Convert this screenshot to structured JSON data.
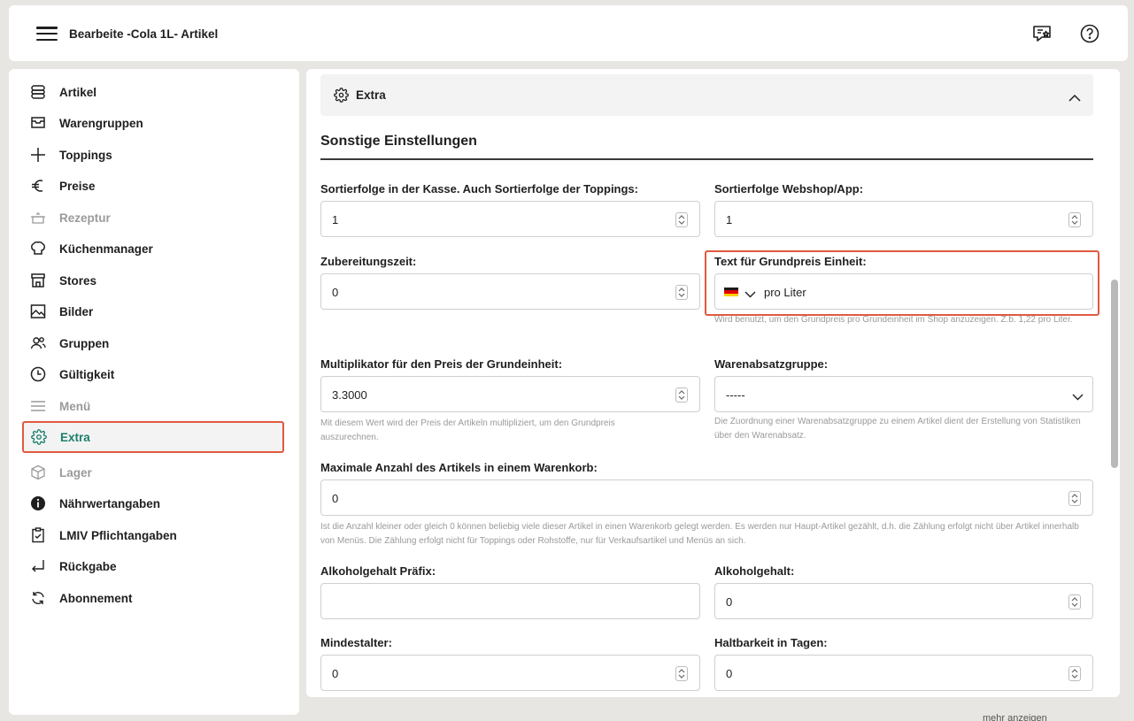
{
  "header": {
    "title": "Bearbeite -Cola 1L- Artikel",
    "icons": [
      "menu-icon",
      "feedback-icon",
      "help-icon"
    ]
  },
  "sidebar": {
    "items": [
      {
        "label": "Artikel",
        "icon": "stack-icon",
        "state": "normal"
      },
      {
        "label": "Warengruppen",
        "icon": "tray-icon",
        "state": "normal"
      },
      {
        "label": "Toppings",
        "icon": "plus-icon",
        "state": "normal"
      },
      {
        "label": "Preise",
        "icon": "euro-icon",
        "state": "normal"
      },
      {
        "label": "Rezeptur",
        "icon": "pot-icon",
        "state": "disabled"
      },
      {
        "label": "Küchenmanager",
        "icon": "chef-hat-icon",
        "state": "normal"
      },
      {
        "label": "Stores",
        "icon": "store-icon",
        "state": "normal"
      },
      {
        "label": "Bilder",
        "icon": "image-icon",
        "state": "normal"
      },
      {
        "label": "Gruppen",
        "icon": "users-icon",
        "state": "normal"
      },
      {
        "label": "Gültigkeit",
        "icon": "clock-icon",
        "state": "normal"
      },
      {
        "label": "Menü",
        "icon": "lines-icon",
        "state": "disabled"
      },
      {
        "label": "Extra",
        "icon": "gear-icon",
        "state": "active"
      },
      {
        "label": "Lager",
        "icon": "box-icon",
        "state": "disabled"
      },
      {
        "label": "Nährwertangaben",
        "icon": "info-icon",
        "state": "normal"
      },
      {
        "label": "LMIV Pflichtangaben",
        "icon": "clipboard-icon",
        "state": "normal"
      },
      {
        "label": "Rückgabe",
        "icon": "return-icon",
        "state": "normal"
      },
      {
        "label": "Abonnement",
        "icon": "refresh-icon",
        "state": "normal"
      }
    ],
    "active_color": "#1a7f6c",
    "highlight_color": "#e05a40"
  },
  "main": {
    "accordion_title": "Extra",
    "section_title": "Sonstige Einstellungen",
    "fields": {
      "sort_pos": {
        "label": "Sortierfolge in der Kasse. Auch Sortierfolge der Toppings:",
        "value": "1"
      },
      "sort_web": {
        "label": "Sortierfolge Webshop/App:",
        "value": "1"
      },
      "prep_time": {
        "label": "Zubereitungszeit:",
        "value": "0"
      },
      "unit_text": {
        "label": "Text für Grundpreis Einheit:",
        "value": "pro Liter",
        "language_flag": "german-flag-icon",
        "help": "Wird benutzt, um den Grundpreis pro Grundeinheit im Shop anzuzeigen. Z.b. 1,22 pro Liter."
      },
      "multiplier": {
        "label": "Multiplikator für den Preis der Grundeinheit:",
        "value": "3.3000",
        "help": "Mit diesem Wert wird der Preis der Artikeln multipliziert, um den Grundpreis auszurechnen."
      },
      "sales_group": {
        "label": "Warenabsatzgruppe:",
        "value": "-----",
        "help": "Die Zuordnung einer Warenabsatzgruppe zu einem Artikel dient der Erstellung von Statistiken über den Warenabsatz."
      },
      "max_cart": {
        "label": "Maximale Anzahl des Artikels in einem Warenkorb:",
        "value": "0",
        "help": "Ist die Anzahl kleiner oder gleich 0 können beliebig viele dieser Artikel in einen Warenkorb gelegt werden. Es werden nur Haupt-Artikel gezählt, d.h. die Zählung erfolgt nicht über Artikel innerhalb von Menüs. Die Zählung erfolgt nicht für Toppings oder Rohstoffe, nur für Verkaufsartikel und Menüs an sich."
      },
      "alc_prefix": {
        "label": "Alkoholgehalt Präfix:",
        "value": ""
      },
      "alc": {
        "label": "Alkoholgehalt:",
        "value": "0"
      },
      "min_age": {
        "label": "Mindestalter:",
        "value": "0"
      },
      "shelf_life": {
        "label": "Haltbarkeit in Tagen:",
        "value": "0"
      }
    }
  },
  "footer": {
    "more_link": "mehr anzeigen"
  }
}
